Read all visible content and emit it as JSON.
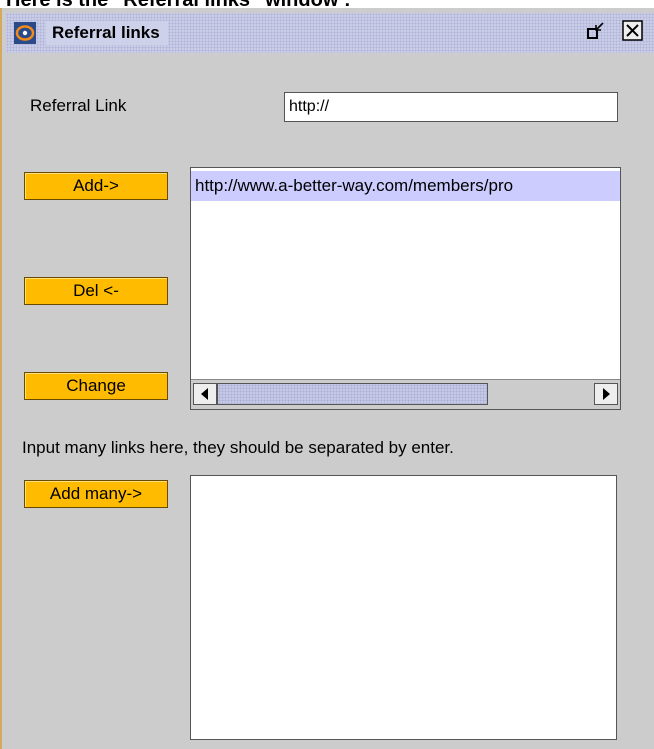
{
  "caption": "Here is the \"Referral links\" window :",
  "window": {
    "title": "Referral links",
    "icons": {
      "app": "app-logo-icon",
      "restore": "restore-window-icon",
      "close": "close-icon"
    }
  },
  "form": {
    "referral_label": "Referral Link",
    "referral_value": "http://"
  },
  "buttons": {
    "add": "Add->",
    "delete": "Del <-",
    "change": "Change",
    "add_many": "Add many->"
  },
  "list": {
    "items": [
      "http://www.a-better-way.com/members/pro"
    ],
    "selected_index": 0,
    "horizontal_scroll_fraction": 0.0,
    "horizontal_visible_fraction": 0.72
  },
  "instruction": "Input many links here, they should be separated by enter.",
  "many_links": {
    "value": ""
  },
  "colors": {
    "button": "#ffbb00",
    "window_bg": "#cccccc",
    "selection": "#ccccff",
    "titlebar": "#cdd1ea"
  }
}
